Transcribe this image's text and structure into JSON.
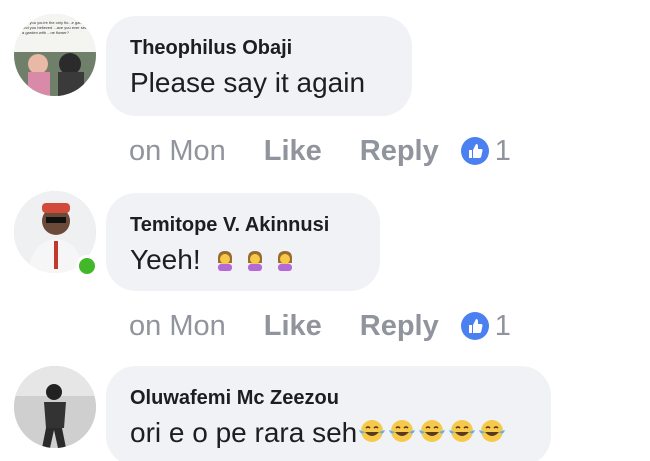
{
  "comments": [
    {
      "author": "Theophilus Obaji",
      "text": "Please say it again",
      "time": "on Mon",
      "like_label": "Like",
      "reply_label": "Reply",
      "like_count": "1",
      "avatar_caption": "...id you you're the only flo...e garden and you believed ...ave you ever seen a garden with ...ne flower?"
    },
    {
      "author": "Temitope V. Akinnusi",
      "text": "Yeeh!",
      "emoji_icons": [
        "woman-facepalming-emoji",
        "woman-facepalming-emoji",
        "woman-facepalming-emoji"
      ],
      "time": "on Mon",
      "like_label": "Like",
      "reply_label": "Reply",
      "like_count": "1",
      "online": true
    },
    {
      "author": "Oluwafemi Mc Zeezou",
      "text": "ori e o pe rara seh",
      "emoji_icons": [
        "face-with-tears-of-joy-emoji",
        "face-with-tears-of-joy-emoji",
        "face-with-tears-of-joy-emoji",
        "face-with-tears-of-joy-emoji",
        "face-with-tears-of-joy-emoji"
      ]
    }
  ],
  "colors": {
    "bubble": "#f1f2f5",
    "meta_text": "#90949c",
    "like_blue": "#4a80f0",
    "online_green": "#42b72a"
  }
}
